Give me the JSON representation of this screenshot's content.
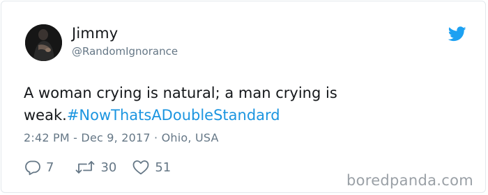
{
  "tweet": {
    "user": {
      "display_name": "Jimmy",
      "handle": "@RandomIgnorance"
    },
    "text": "A woman crying is natural; a man crying is weak.",
    "hashtag": "#NowThatsADoubleStandard",
    "time": "2:42 PM",
    "date": "Dec 9, 2017",
    "location": "Ohio, USA",
    "meta_separator_1": " - ",
    "meta_separator_2": " · ",
    "replies": "7",
    "retweets": "30",
    "likes": "51"
  },
  "watermark": "boredpanda.com",
  "colors": {
    "text": "#14171a",
    "secondary": "#657786",
    "link": "#1b95e0",
    "twitter_brand": "#1da1f2",
    "watermark": "#9aa0a6"
  },
  "icons": {
    "brand": "twitter-bird-icon",
    "reply": "reply-icon",
    "retweet": "retweet-icon",
    "like": "heart-icon"
  }
}
